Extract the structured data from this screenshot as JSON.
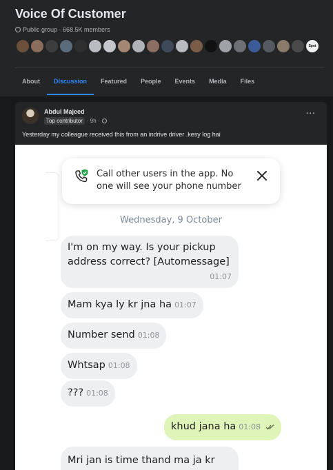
{
  "group": {
    "title": "Voice Of Customer",
    "meta": "Public group · 668.5K members",
    "member_avatar_colors": [
      "#6b4f3a",
      "#8a6d5a",
      "#3d3d3d",
      "#5a6b7c",
      "#2f2f2f",
      "#b9bcc0",
      "#c4c7cb",
      "#a38772",
      "#b0b3b8",
      "#8d6e63",
      "#3e4a5a",
      "#b9bcc0",
      "#7a5c48",
      "#111111",
      "#9fa3a8",
      "#6d7075",
      "#3b5b9a",
      "#555a60",
      "#8a7a6a",
      "#4a4a4a",
      "#f0f0f0"
    ],
    "last_avatar_label": "Spot"
  },
  "tabs": [
    {
      "label": "About"
    },
    {
      "label": "Discussion",
      "active": true
    },
    {
      "label": "Featured"
    },
    {
      "label": "People"
    },
    {
      "label": "Events"
    },
    {
      "label": "Media"
    },
    {
      "label": "Files"
    }
  ],
  "post": {
    "author": "Abdul Majeed",
    "badge": "Top contributor",
    "time": "· 9h ·",
    "text": "Yesterday my colleague received this from an indrive driver .kesy log hai",
    "more_icon": "more-dots-icon"
  },
  "chat": {
    "call_notice": "Call other users in the app. No one will see your phone number",
    "call_icon": "phone-shield-icon",
    "close_icon": "close-icon",
    "date": "Wednesday, 9 October",
    "messages": [
      {
        "text": "I'm on my way. Is your pickup address correct? [Automessage]",
        "time": "01:07"
      },
      {
        "text": "Mam kya ly kr jna ha",
        "time": "01:07"
      },
      {
        "text": "Number send",
        "time": "01:08"
      },
      {
        "text": "Whtsap",
        "time": "01:08"
      },
      {
        "text": "???",
        "time": "01:08"
      },
      {
        "text": "khud jana ha",
        "time": "01:08",
        "outgoing": true,
        "status_icon": "double-check-icon"
      },
      {
        "text": "Mri jan is time thand ma ja kr",
        "time": ""
      }
    ],
    "colors": {
      "incoming": "#eeeff1",
      "outgoing": "#dff4b8",
      "accent": "#2d88ff",
      "shield": "#22a447"
    }
  }
}
